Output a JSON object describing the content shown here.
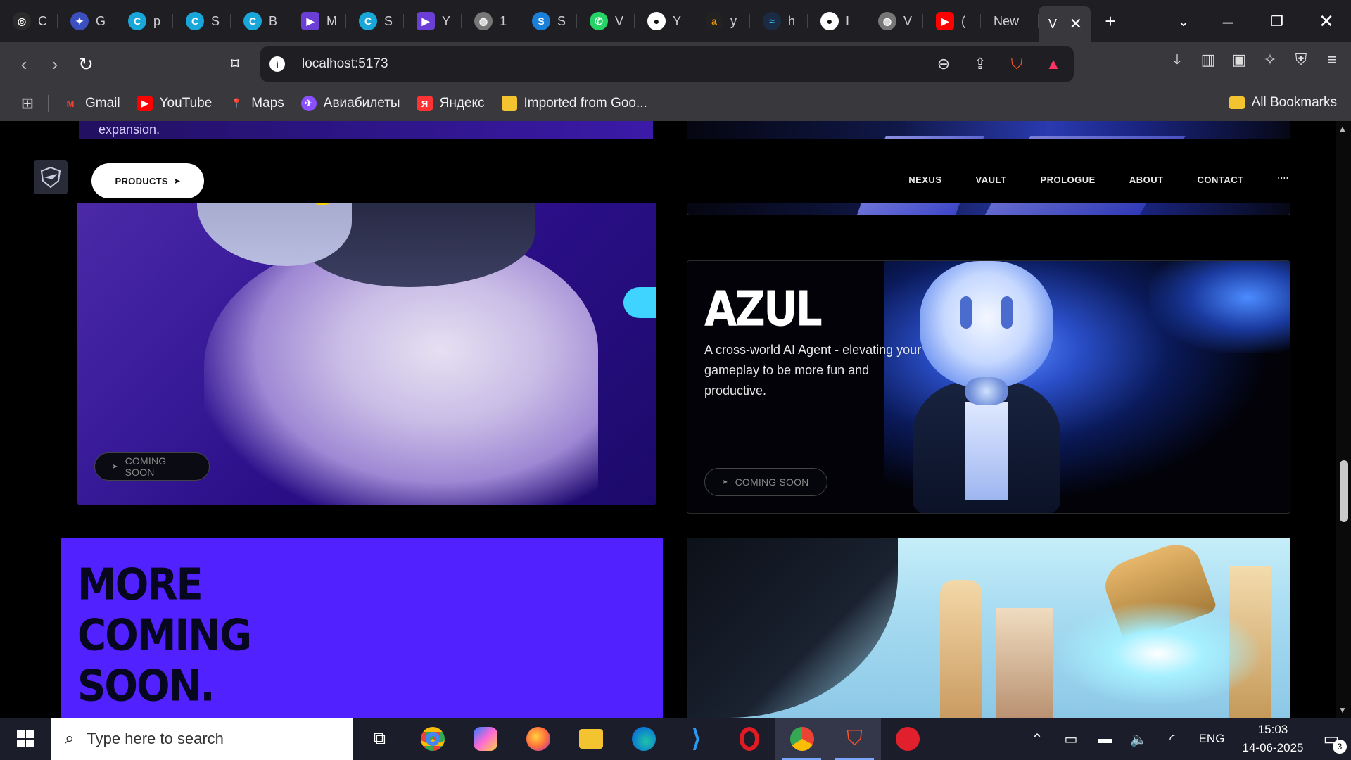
{
  "browser": {
    "tabs": [
      {
        "icon": "openai-icon",
        "label": "C",
        "color": "#2b2b2b"
      },
      {
        "icon": "gemini-icon",
        "label": "G",
        "color": "#3b4fbf"
      },
      {
        "icon": "canva-icon",
        "label": "p",
        "color": "#19a6d8"
      },
      {
        "icon": "canva-icon",
        "label": "S",
        "color": "#19a6d8"
      },
      {
        "icon": "canva-icon",
        "label": "B",
        "color": "#19a6d8"
      },
      {
        "icon": "video-icon",
        "label": "M",
        "color": "#6b3fd6"
      },
      {
        "icon": "canva-icon",
        "label": "S",
        "color": "#19a6d8"
      },
      {
        "icon": "video-icon",
        "label": "Y",
        "color": "#6b3fd6"
      },
      {
        "icon": "globe-icon",
        "label": "1",
        "color": "#777777"
      },
      {
        "icon": "s-icon",
        "label": "S",
        "color": "#1a7fd8"
      },
      {
        "icon": "whatsapp-icon",
        "label": "V",
        "color": "#25d366"
      },
      {
        "icon": "github-icon",
        "label": "Y",
        "color": "#333333"
      },
      {
        "icon": "amazon-icon",
        "label": "y",
        "color": "#222222"
      },
      {
        "icon": "tailwind-icon",
        "label": "h",
        "color": "#38bdf8"
      },
      {
        "icon": "github-icon",
        "label": "I",
        "color": "#333333"
      },
      {
        "icon": "globe-icon",
        "label": "V",
        "color": "#777777"
      },
      {
        "icon": "youtube-icon",
        "label": "(",
        "color": "#ff0000"
      }
    ],
    "new_tab_label": "New",
    "active_tab_label": "V",
    "url": "localhost:5173",
    "bookmarks": [
      {
        "label": "Gmail",
        "icon": "gmail-icon",
        "color": "#ea4335"
      },
      {
        "label": "YouTube",
        "icon": "youtube-icon",
        "color": "#ff0000"
      },
      {
        "label": "Maps",
        "icon": "maps-icon",
        "color": "#34a853"
      },
      {
        "label": "Авиабилеты",
        "icon": "aviasales-icon",
        "color": "#8a4fff"
      },
      {
        "label": "Яндекс",
        "icon": "yandex-icon",
        "color": "#ff3333"
      },
      {
        "label": "Imported from Goo...",
        "icon": "folder-icon",
        "color": "#f4c430"
      }
    ],
    "all_bookmarks_label": "All Bookmarks"
  },
  "page": {
    "products_label": "PRODUCTS",
    "menu": [
      "NEXUS",
      "VAULT",
      "PROLOGUE",
      "ABOUT",
      "CONTACT"
    ],
    "menu_more": "''''",
    "left_top_text": "expansion.",
    "coming_soon": "COMING SOON",
    "azul_title": "AZUL",
    "azul_desc": "A cross-world AI Agent - elevating your gameplay to be more fun and productive.",
    "more_lines": [
      "MORE",
      "COMING",
      "SOON."
    ]
  },
  "taskbar": {
    "search_placeholder": "Type here to search",
    "apps": [
      "task-view-icon",
      "chrome-icon",
      "copilot-icon",
      "firefox-icon",
      "file-explorer-icon",
      "edge-icon",
      "vscode-icon",
      "opera-icon",
      "chrome-profile-icon",
      "brave-icon",
      "app-red-icon"
    ],
    "language": "ENG",
    "time": "15:03",
    "date": "14-06-2025",
    "notifications": "3"
  },
  "colors": {
    "accent_purple": "#5221ff",
    "chrome_dark": "#1f1f23",
    "chrome_mid": "#38383d"
  }
}
